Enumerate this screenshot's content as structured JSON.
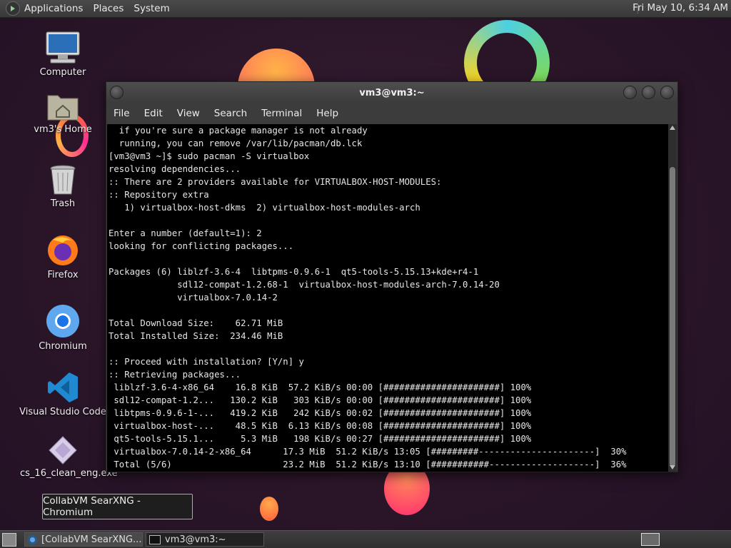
{
  "top_panel": {
    "menus": [
      "Applications",
      "Places",
      "System"
    ],
    "clock": "Fri May 10,  6:34 AM"
  },
  "desktop_icons": [
    {
      "label": "Computer",
      "icon": "computer-icon"
    },
    {
      "label": "vm3's Home",
      "icon": "home-folder-icon"
    },
    {
      "label": "Trash",
      "icon": "trash-icon"
    },
    {
      "label": "Firefox",
      "icon": "firefox-icon"
    },
    {
      "label": "Chromium",
      "icon": "chromium-icon"
    },
    {
      "label": "Visual Studio Code",
      "icon": "vscode-icon"
    },
    {
      "label": "cs_16_clean_eng.exe",
      "icon": "exe-file-icon"
    }
  ],
  "window": {
    "title": "vm3@vm3:~",
    "menus": [
      "File",
      "Edit",
      "View",
      "Search",
      "Terminal",
      "Help"
    ]
  },
  "terminal": {
    "lines": [
      "  if you're sure a package manager is not already",
      "  running, you can remove /var/lib/pacman/db.lck",
      "[vm3@vm3 ~]$ sudo pacman -S virtualbox",
      "resolving dependencies...",
      ":: There are 2 providers available for VIRTUALBOX-HOST-MODULES:",
      ":: Repository extra",
      "   1) virtualbox-host-dkms  2) virtualbox-host-modules-arch",
      "",
      "Enter a number (default=1): 2",
      "looking for conflicting packages...",
      "",
      "Packages (6) liblzf-3.6-4  libtpms-0.9.6-1  qt5-tools-5.15.13+kde+r4-1",
      "             sdl12-compat-1.2.68-1  virtualbox-host-modules-arch-7.0.14-20",
      "             virtualbox-7.0.14-2",
      "",
      "Total Download Size:    62.71 MiB",
      "Total Installed Size:  234.46 MiB",
      "",
      ":: Proceed with installation? [Y/n] y",
      ":: Retrieving packages...",
      " liblzf-3.6-4-x86_64    16.8 KiB  57.2 KiB/s 00:00 [######################] 100%",
      " sdl12-compat-1.2...   130.2 KiB   303 KiB/s 00:00 [######################] 100%",
      " libtpms-0.9.6-1-...   419.2 KiB   242 KiB/s 00:02 [######################] 100%",
      " virtualbox-host-...    48.5 KiB  6.13 KiB/s 00:08 [######################] 100%",
      " qt5-tools-5.15.1...     5.3 MiB   198 KiB/s 00:27 [######################] 100%",
      " virtualbox-7.0.14-2-x86_64      17.3 MiB  51.2 KiB/s 13:05 [#########----------------------]  30%",
      " Total (5/6)                     23.2 MiB  51.2 KiB/s 13:10 [###########--------------------]  36%"
    ]
  },
  "tooltip": "CollabVM SearXNG - Chromium",
  "taskbar": {
    "tasks": [
      {
        "label": "[CollabVM SearXNG...",
        "icon": "chromium-icon",
        "active": false
      },
      {
        "label": "vm3@vm3:~",
        "icon": "terminal-icon",
        "active": true
      }
    ]
  }
}
